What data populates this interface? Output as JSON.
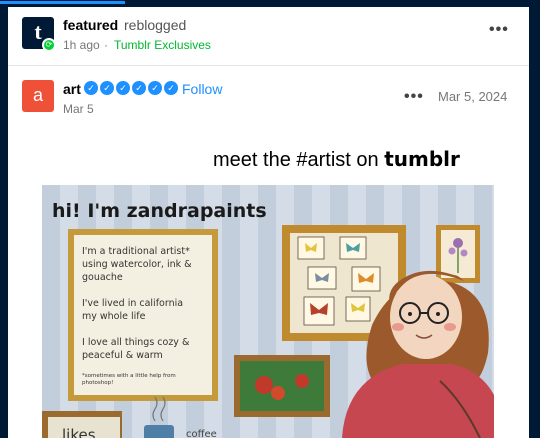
{
  "colors": {
    "brand_navy": "#001935",
    "link_blue": "#1e90ff",
    "green": "#00b830",
    "avatar_red": "#ef5138"
  },
  "reblog_header": {
    "blog_name": "featured",
    "action": "reblogged",
    "time": "1h ago",
    "separator": "·",
    "source": "Tumblr Exclusives",
    "avatar_letter": "t",
    "more_icon": "more-dots-icon"
  },
  "post_header": {
    "blog_name": "art",
    "avatar_letter": "a",
    "verified_badge_count": 6,
    "follow_label": "Follow",
    "date_short": "Mar 5",
    "date_full": "Mar 5, 2024"
  },
  "caption": {
    "prefix": "meet the #artist on ",
    "brand": "tumblr"
  },
  "artwork": {
    "title": "hi! I'm zandrapaints",
    "notes": [
      "I'm a traditional artist* using watercolor, ink & gouache",
      "I've lived in california my whole life",
      "I love all things cozy & peaceful & warm"
    ],
    "footnote": "*sometimes with a little help from photoshop!",
    "likes_label": "likes...",
    "coffee_label": "coffee"
  }
}
